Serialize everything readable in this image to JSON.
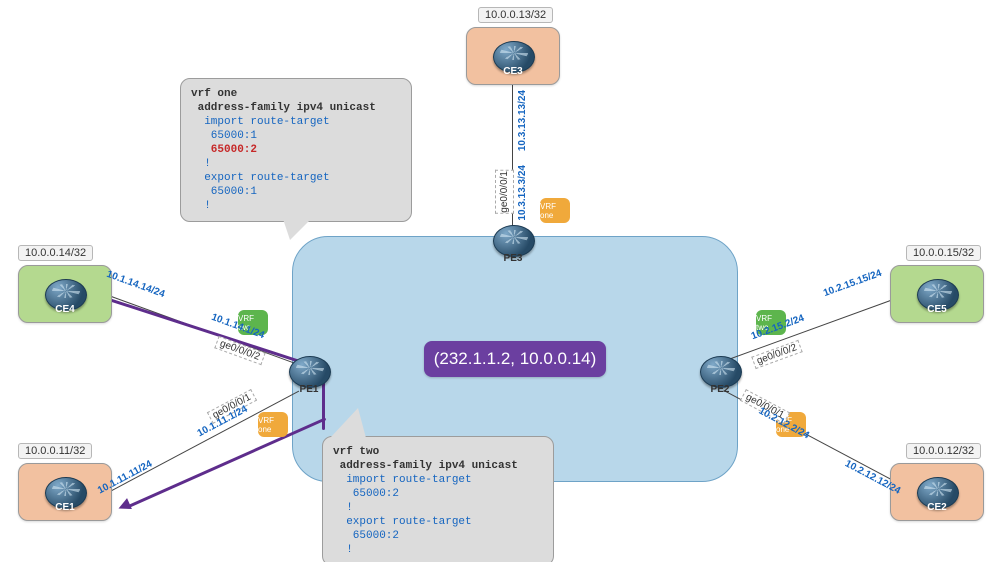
{
  "diagram": {
    "badge": "(232.1.1.2, 10.0.0.14)",
    "nodes": {
      "ce1": {
        "label": "CE1",
        "ip": "10.0.0.11/32"
      },
      "ce2": {
        "label": "CE2",
        "ip": "10.0.0.12/32"
      },
      "ce3": {
        "label": "CE3",
        "ip": "10.0.0.13/32"
      },
      "ce4": {
        "label": "CE4",
        "ip": "10.0.0.14/32"
      },
      "ce5": {
        "label": "CE5",
        "ip": "10.0.0.15/32"
      },
      "pe1": {
        "label": "PE1"
      },
      "pe2": {
        "label": "PE2"
      },
      "pe3": {
        "label": "PE3"
      }
    },
    "vrf": {
      "one_text": "VRF\none",
      "two_text": "VRF\ntwo"
    },
    "links": {
      "ce4_pe1": {
        "ce_ip": "10.1.14.14/24",
        "pe_ip": "10.1.14.1/24",
        "iface": "ge0/0/0/2"
      },
      "ce1_pe1": {
        "ce_ip": "10.1.11.11/24",
        "pe_ip": "10.1.11.1/24",
        "iface": "ge0/0/0/1"
      },
      "ce5_pe2": {
        "ce_ip": "10.2.15.15/24",
        "pe_ip": "10.2.15.2/24",
        "iface": "ge0/0/0/2"
      },
      "ce2_pe2": {
        "ce_ip": "10.2.12.12/24",
        "pe_ip": "10.2.12.2/24",
        "iface": "ge0/0/0/1"
      },
      "ce3_pe3": {
        "ce_ip": "10.3.13.13/24",
        "pe_ip": "10.3.13.3/24",
        "iface": "ge0/0/0/1"
      }
    },
    "config_top": {
      "l1": "vrf one",
      "l2": " address-family ipv4 unicast",
      "l3": "  import route-target",
      "l4": "   65000:1",
      "l5": "   65000:2",
      "l6": "  !",
      "l7": "  export route-target",
      "l8": "   65000:1",
      "l9": "  !"
    },
    "config_bot": {
      "l1": "vrf two",
      "l2": " address-family ipv4 unicast",
      "l3": "  import route-target",
      "l4": "   65000:2",
      "l5": "  !",
      "l6": "  export route-target",
      "l7": "   65000:2",
      "l8": "  !"
    }
  }
}
